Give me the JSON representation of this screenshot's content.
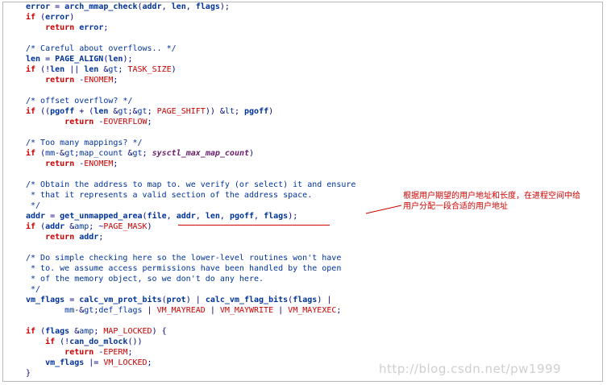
{
  "code": {
    "lines": [
      "error = arch_mmap_check(addr, len, flags);",
      "if (error)",
      "    return error;",
      "",
      "/* Careful about overflows.. */",
      "len = PAGE_ALIGN(len);",
      "if (!len || len > TASK_SIZE)",
      "    return -ENOMEM;",
      "",
      "/* offset overflow? */",
      "if ((pgoff + (len >> PAGE_SHIFT)) < pgoff)",
      "        return -EOVERFLOW;",
      "",
      "/* Too many mappings? */",
      "if (mm->map_count > sysctl_max_map_count)",
      "    return -ENOMEM;",
      "",
      "/* Obtain the address to map to. we verify (or select) it and ensure",
      " * that it represents a valid section of the address space.",
      " */",
      "addr = get_unmapped_area(file, addr, len, pgoff, flags);",
      "if (addr & ~PAGE_MASK)",
      "    return addr;",
      "",
      "/* Do simple checking here so the lower-level routines won't have",
      " * to. we assume access permissions have been handled by the open",
      " * of the memory object, so we don't do any here.",
      " */",
      "vm_flags = calc_vm_prot_bits(prot) | calc_vm_flag_bits(flags) |",
      "        mm->def_flags | VM_MAYREAD | VM_MAYWRITE | VM_MAYEXEC;",
      "",
      "if (flags & MAP_LOCKED) {",
      "    if (!can_do_mlock())",
      "        return -EPERM;",
      "    vm_flags |= VM_LOCKED;",
      "}"
    ]
  },
  "annotation": {
    "line1": "根据用户期望的用户地址和长度，在进程空间中给",
    "line2": "用户分配一段合适的用户地址"
  },
  "watermark": "http://blog.csdn.net/pw1999",
  "colors": {
    "keyword": "#cc0000",
    "function": "#003399",
    "comment": "#003399",
    "annotation": "#d00000",
    "watermark": "#cfcfcf"
  }
}
